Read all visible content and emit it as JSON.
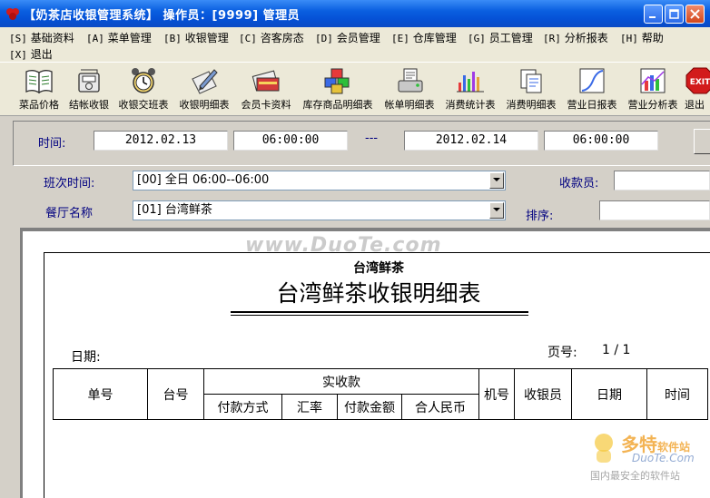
{
  "window": {
    "title": "【奶茶店收银管理系统】   操作员：[9999] 管理员"
  },
  "menu": [
    {
      "key": "[S]",
      "label": "基础资料"
    },
    {
      "key": "[A]",
      "label": "菜单管理"
    },
    {
      "key": "[B]",
      "label": "收银管理"
    },
    {
      "key": "[C]",
      "label": "咨客房态"
    },
    {
      "key": "[D]",
      "label": "会员管理"
    },
    {
      "key": "[E]",
      "label": "仓库管理"
    },
    {
      "key": "[G]",
      "label": "员工管理"
    },
    {
      "key": "[R]",
      "label": "分析报表"
    },
    {
      "key": "[H]",
      "label": "帮助"
    },
    {
      "key": "[X]",
      "label": "退出"
    }
  ],
  "toolbar": [
    {
      "label": "菜品价格",
      "icon": "book-icon"
    },
    {
      "label": "结帐收银",
      "icon": "cash-register-icon"
    },
    {
      "label": "收银交班表",
      "icon": "alarm-clock-icon"
    },
    {
      "label": "收银明细表",
      "icon": "pen-paper-icon"
    },
    {
      "label": "会员卡资料",
      "icon": "card-icon"
    },
    {
      "label": "库存商品明细表",
      "icon": "cubes-icon"
    },
    {
      "label": "帐单明细表",
      "icon": "receipt-printer-icon"
    },
    {
      "label": "消费统计表",
      "icon": "bar-chart-icon"
    },
    {
      "label": "消费明细表",
      "icon": "documents-icon"
    },
    {
      "label": "营业日报表",
      "icon": "curve-chart-icon"
    },
    {
      "label": "营业分析表",
      "icon": "analysis-chart-icon"
    },
    {
      "label": "退出",
      "icon": "exit-icon"
    }
  ],
  "filters": {
    "time_label": "时间:",
    "start_date": "2012.02.13",
    "start_time": "06:00:00",
    "separator": "---",
    "end_date": "2012.02.14",
    "end_time": "06:00:00",
    "shift_label": "班次时间:",
    "shift_value": "[00] 全日 06:00--06:00",
    "cashier_label": "收款员:",
    "restaurant_label": "餐厅名称",
    "restaurant_value": "[01] 台湾鲜茶",
    "sort_label": "排序:"
  },
  "report": {
    "org": "台湾鲜茶",
    "title": "台湾鲜茶收银明细表",
    "date_label": "日期:",
    "page_label": "页号:",
    "page_value": "1 / 1",
    "columns": {
      "bill_no": "单号",
      "table_no": "台号",
      "received": "实收款",
      "pay_method": "付款方式",
      "rate": "汇率",
      "pay_amount": "付款金额",
      "rmb_total": "合人民币",
      "machine_no": "机号",
      "cashier": "收银员",
      "date": "日期",
      "time": "时间"
    }
  },
  "watermarks": {
    "center": "www.DuoTe.com",
    "logo_main": "多特",
    "logo_sub": "软件站",
    "logo_url": "DuoTe.Com",
    "logo_slogan": "国内最安全的软件站"
  }
}
